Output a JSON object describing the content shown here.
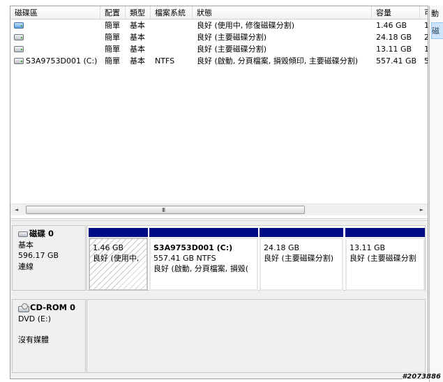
{
  "volume_list": {
    "columns": [
      "磁碟區",
      "配置",
      "類型",
      "檔案系統",
      "狀態",
      "容量",
      "可"
    ],
    "rows": [
      {
        "icon": "drive-blue-icon",
        "name": "",
        "layout": "簡單",
        "type": "基本",
        "fs": "",
        "status": "良好 (使用中, 修復磁碟分割)",
        "capacity": "1.46 GB",
        "free": "1"
      },
      {
        "icon": "drive-icon",
        "name": "",
        "layout": "簡單",
        "type": "基本",
        "fs": "",
        "status": "良好 (主要磁碟分割)",
        "capacity": "24.18 GB",
        "free": "2"
      },
      {
        "icon": "drive-icon",
        "name": "",
        "layout": "簡單",
        "type": "基本",
        "fs": "",
        "status": "良好 (主要磁碟分割)",
        "capacity": "13.11 GB",
        "free": "1"
      },
      {
        "icon": "drive-icon",
        "name": "S3A9753D001 (C:)",
        "layout": "簡單",
        "type": "基本",
        "fs": "NTFS",
        "status": "良好 (啟動, 分頁檔案, 損毀傾印, 主要磁碟分割)",
        "capacity": "557.41 GB",
        "free": "5"
      }
    ],
    "scroll_left": "◄",
    "scroll_right": "►",
    "scroll_grip": "III"
  },
  "disks": [
    {
      "name": "磁碟 0",
      "type": "基本",
      "size": "596.17 GB",
      "state": "連線",
      "partitions": [
        {
          "title": "",
          "size": "1.46 GB",
          "status": "良好 (使用中,",
          "hatched": true
        },
        {
          "title": "S3A9753D001  (C:)",
          "size": "557.41 GB NTFS",
          "status": "良好 (啟動, 分頁檔案, 損毀("
        },
        {
          "title": "",
          "size": "24.18 GB",
          "status": "良好 (主要磁碟分割)"
        },
        {
          "title": "",
          "size": "13.11 GB",
          "status": "良好 (主要磁碟分割"
        }
      ]
    }
  ],
  "cdrom": {
    "name": "CD-ROM 0",
    "drive": "DVD (E:)",
    "state": "沒有媒體"
  },
  "actions_pane": {
    "header": "動",
    "selected": "磁"
  },
  "watermark": "#2073886",
  "colors": {
    "partition_bar": "#000c86",
    "selection": "#cde5fa"
  }
}
